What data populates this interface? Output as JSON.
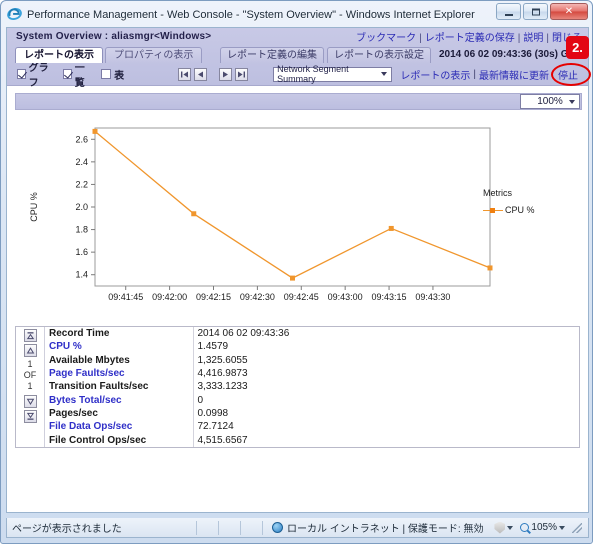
{
  "window": {
    "title": "Performance Management - Web Console - \"System Overview\" - Windows Internet Explorer",
    "minimize_label": "Minimize",
    "maximize_label": "Maximize",
    "close_label": "✕"
  },
  "app_header": {
    "system_title": "System Overview : aliasmgr<Windows>",
    "links": [
      {
        "label": "ブックマーク"
      },
      {
        "label": "レポート定義の保存"
      },
      {
        "label": "説明"
      },
      {
        "label": "閉じる"
      }
    ],
    "separator": "|"
  },
  "tabs": [
    {
      "label": "レポートの表示",
      "active": true
    },
    {
      "label": "プロパティの表示",
      "active": false
    }
  ],
  "tab_tools": [
    {
      "label": "レポート定義の編集"
    },
    {
      "label": "レポートの表示設定"
    }
  ],
  "timestamp": "2014 06 02 09:43:36  (30s)  GMT+09:0",
  "annotation_badge": "2.",
  "controls": {
    "checkboxes": [
      {
        "label": "グラフ",
        "checked": true
      },
      {
        "label": "一覧",
        "checked": true
      },
      {
        "label": "表",
        "checked": false
      }
    ],
    "nav_buttons": [
      {
        "name": "first-page-button",
        "glyph": "first"
      },
      {
        "name": "previous-page-button",
        "glyph": "prev"
      },
      {
        "name": "next-page-button",
        "glyph": "next"
      },
      {
        "name": "last-page-button",
        "glyph": "last"
      }
    ],
    "report_select": {
      "value": "Network Segment Summary"
    },
    "action_links": [
      {
        "label": "レポートの表示"
      },
      {
        "label": "最新情報に更新"
      }
    ],
    "separator": "|",
    "stop_link": "停止"
  },
  "zoom_strip": {
    "zoom_value": "100%"
  },
  "chart_data": {
    "type": "line",
    "title": "",
    "xlabel": "",
    "ylabel": "CPU %",
    "x": [
      "09:41:36",
      "09:42:06",
      "09:42:36",
      "09:43:06",
      "09:43:36"
    ],
    "tick_labels": [
      "09:41:45",
      "09:42:00",
      "09:42:15",
      "09:42:30",
      "09:42:45",
      "09:43:00",
      "09:43:15",
      "09:43:30"
    ],
    "series": [
      {
        "name": "CPU %",
        "color": "#f0962d",
        "values": [
          2.67,
          1.94,
          1.37,
          1.81,
          1.46
        ]
      }
    ],
    "ylim": [
      1.3,
      2.7
    ],
    "yticks": [
      1.4,
      1.6,
      1.8,
      2.0,
      2.2,
      2.4,
      2.6
    ],
    "ytick_labels": [
      "1.4",
      "1.6",
      "1.8",
      "2.0",
      "2.2",
      "2.4",
      "2.6"
    ],
    "grid": false,
    "legend_position": "right",
    "legend_title": "Metrics",
    "legend_entries": [
      "CPU %"
    ]
  },
  "data_table": {
    "pager": {
      "first_label": "first",
      "prev_label": "prev",
      "current_page": "1",
      "of_label": "OF",
      "total_pages": "1",
      "next_label": "next",
      "last_label": "last"
    },
    "rows": [
      {
        "label": "Record Time",
        "value": "2014 06 02 09:43:36",
        "is_link": false
      },
      {
        "label": "CPU %",
        "value": "1.4579",
        "is_link": true
      },
      {
        "label": "Available Mbytes",
        "value": "1,325.6055",
        "is_link": false
      },
      {
        "label": "Page Faults/sec",
        "value": "4,416.9873",
        "is_link": true
      },
      {
        "label": "Transition Faults/sec",
        "value": "3,333.1233",
        "is_link": false
      },
      {
        "label": "Bytes Total/sec",
        "value": "0",
        "is_link": true
      },
      {
        "label": "Pages/sec",
        "value": "0.0998",
        "is_link": false
      },
      {
        "label": "File Data Ops/sec",
        "value": "72.7124",
        "is_link": true
      },
      {
        "label": "File Control Ops/sec",
        "value": "4,515.6567",
        "is_link": false
      }
    ]
  },
  "status_bar": {
    "message": "ページが表示されました",
    "zone": "ローカル イントラネット | 保護モード: 無効",
    "zoom": "105%"
  },
  "colors": {
    "accent_orange": "#f0962d",
    "header_purple": "#c8c9e6",
    "link_blue": "#2b2bb5",
    "annotation_red": "#e30613"
  }
}
